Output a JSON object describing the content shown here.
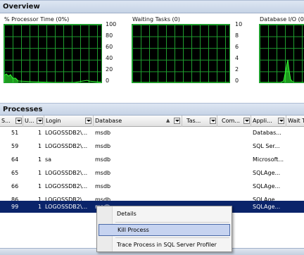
{
  "overview": {
    "title": "Overview"
  },
  "charts": [
    {
      "title": "% Processor Time (0%)",
      "ticks": [
        "100",
        "80",
        "60",
        "40",
        "20",
        "0"
      ]
    },
    {
      "title": "Waiting Tasks (0)",
      "ticks": [
        "10",
        "8",
        "6",
        "4",
        "2",
        "0"
      ]
    },
    {
      "title": "Database I/O (0"
    }
  ],
  "processes": {
    "title": "Processes",
    "columns": [
      "S...",
      "U...",
      "Login",
      "Database",
      "Tas...",
      "Com...",
      "Appli...",
      "Wait T"
    ],
    "rows": [
      {
        "session": "51",
        "user": "1",
        "login": "LOGOSSDB2\\...",
        "database": "msdb",
        "app": "Databas..."
      },
      {
        "session": "59",
        "user": "1",
        "login": "LOGOSSDB2\\...",
        "database": "msdb",
        "app": "SQL Ser..."
      },
      {
        "session": "64",
        "user": "1",
        "login": "sa",
        "database": "msdb",
        "app": "Microsoft..."
      },
      {
        "session": "65",
        "user": "1",
        "login": "LOGOSSDB2\\...",
        "database": "msdb",
        "app": "SQLAge..."
      },
      {
        "session": "66",
        "user": "1",
        "login": "LOGOSSDB2\\...",
        "database": "msdb",
        "app": "SQLAge..."
      },
      {
        "session": "86",
        "user": "1",
        "login": "LOGOSSDB2\\...",
        "database": "msdb",
        "app": "SQLAge..."
      },
      {
        "session": "99",
        "user": "1",
        "login": "LOGOSSDB2\\...",
        "database": "msdb",
        "app": "SQLAge..."
      }
    ],
    "selected_row": 6
  },
  "context_menu": {
    "items": [
      "Details",
      "Kill Process",
      "Trace Process in SQL Server Profiler"
    ],
    "hovered": "Kill Process"
  },
  "colors": {
    "selection": "#0a246a",
    "plot_grid": "#1e9e2e",
    "plot_line": "#33ff33"
  }
}
